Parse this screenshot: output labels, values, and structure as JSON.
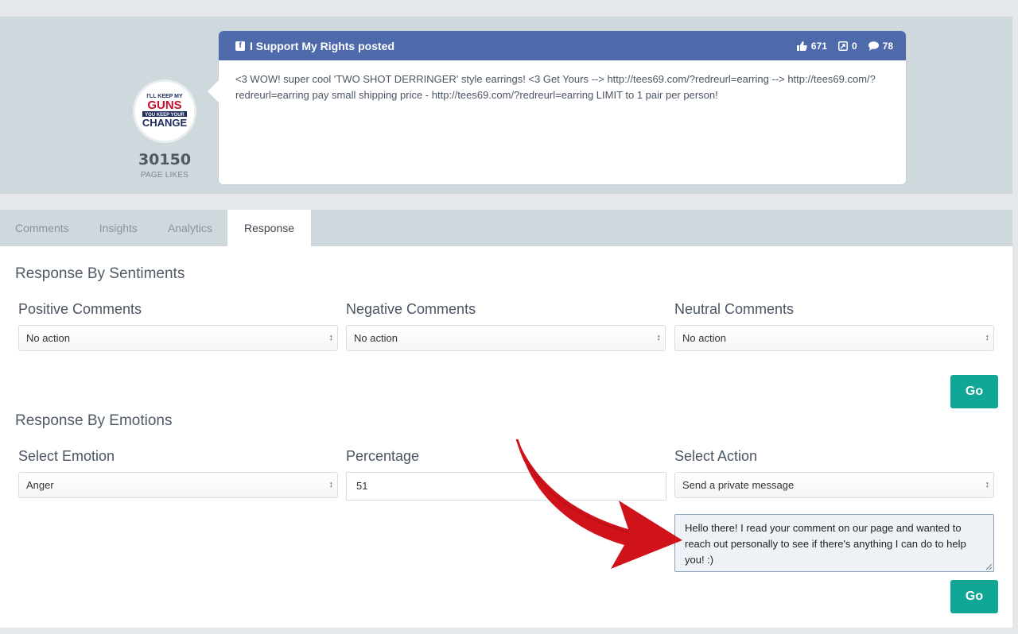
{
  "post": {
    "page_name": "I Support My Rights posted",
    "likes": "671",
    "shares": "0",
    "comments": "78",
    "text": "<3 WOW! super cool 'TWO SHOT DERRINGER' style earrings! <3 Get Yours --> http://tees69.com/?redreurl=earring --> http://tees69.com/?redreurl=earring pay small shipping price - http://tees69.com/?redreurl=earring LIMIT to 1 pair per person!"
  },
  "page": {
    "likes_count": "30150",
    "likes_label": "PAGE LIKES",
    "logo_lines": [
      "I'LL KEEP MY",
      "GUNS",
      "YOU KEEP YOUR",
      "CHANGE"
    ]
  },
  "tabs": [
    "Comments",
    "Insights",
    "Analytics",
    "Response"
  ],
  "active_tab": "Response",
  "sentiments": {
    "title": "Response By Sentiments",
    "positive_label": "Positive Comments",
    "positive_value": "No action",
    "negative_label": "Negative Comments",
    "negative_value": "No action",
    "neutral_label": "Neutral Comments",
    "neutral_value": "No action",
    "go_label": "Go"
  },
  "emotions": {
    "title": "Response By Emotions",
    "emotion_label": "Select Emotion",
    "emotion_value": "Anger",
    "percentage_label": "Percentage",
    "percentage_value": "51",
    "action_label": "Select Action",
    "action_value": "Send a private message",
    "message": "Hello there! I read your comment on our page and wanted to reach out personally to see if there's anything I can do to help you! :)",
    "go_label": "Go"
  },
  "colors": {
    "header_blue": "#4e6aab",
    "go_green": "#11a796",
    "arrow_red": "#d0121b"
  },
  "icons": [
    "facebook-icon",
    "thumbs-up-icon",
    "share-icon",
    "comment-icon",
    "select-arrows-icon",
    "red-arrow-annotation"
  ]
}
